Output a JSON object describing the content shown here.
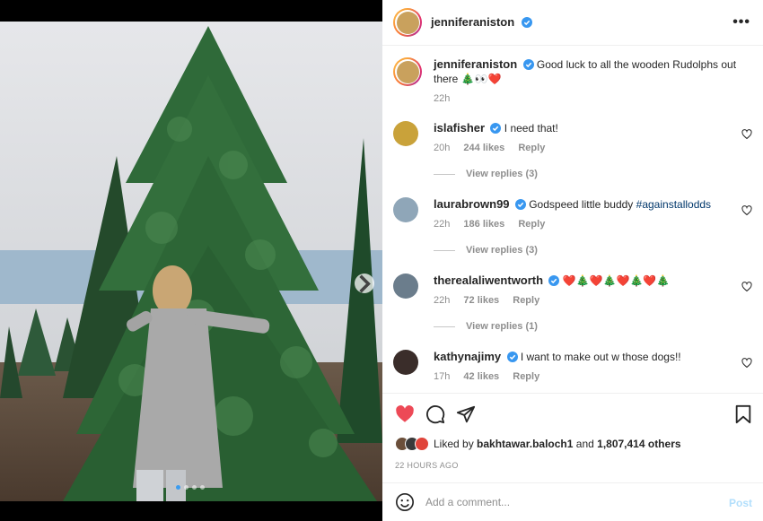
{
  "post": {
    "author": "jenniferaniston",
    "caption": "Good luck to all the wooden Rudolphs out there",
    "caption_emoji": "🎄👀❤️",
    "caption_time": "22h",
    "slides": 4,
    "active_slide": 1
  },
  "comments": [
    {
      "user": "islafisher",
      "text": "I need that!",
      "time": "20h",
      "likes": "244 likes",
      "reply": "Reply",
      "view_replies": "View replies (3)",
      "avatar_color": "#c9a23a"
    },
    {
      "user": "laurabrown99",
      "text": "Godspeed little buddy",
      "hashtag": "#againstallodds",
      "time": "22h",
      "likes": "186 likes",
      "reply": "Reply",
      "view_replies": "View replies (3)",
      "avatar_color": "#8fa6b8"
    },
    {
      "user": "therealaliwentworth",
      "text": "❤️🎄❤️🎄❤️🎄❤️🎄",
      "time": "22h",
      "likes": "72 likes",
      "reply": "Reply",
      "view_replies": "View replies (1)",
      "avatar_color": "#6b7d8c"
    },
    {
      "user": "kathynajimy",
      "text": "I want to make out w those dogs!!",
      "time": "17h",
      "likes": "42 likes",
      "reply": "Reply",
      "avatar_color": "#3a2d2a"
    }
  ],
  "likes": {
    "liked_by_prefix": "Liked by",
    "liked_by_user": "bakhtawar.baloch1",
    "and": "and",
    "others": "1,807,414 others"
  },
  "timestamp": "22 HOURS AGO",
  "add_comment": {
    "placeholder": "Add a comment...",
    "post_label": "Post"
  },
  "colors": {
    "verified": "#3897f0",
    "like_red": "#ed4956",
    "post_disabled": "#b2dffc"
  }
}
